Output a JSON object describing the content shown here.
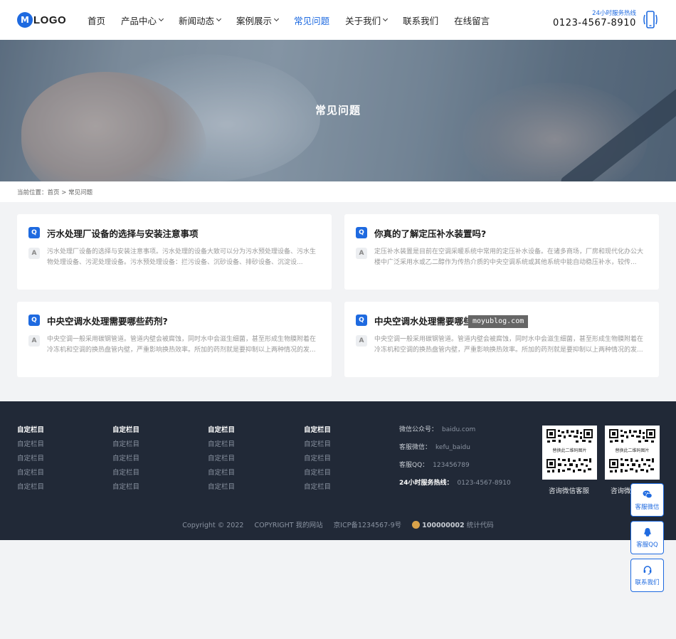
{
  "header": {
    "logo_badge": "M",
    "logo_text": "LOGO",
    "nav": [
      {
        "label": "首页",
        "dropdown": false,
        "active": false
      },
      {
        "label": "产品中心",
        "dropdown": true,
        "active": false
      },
      {
        "label": "新闻动态",
        "dropdown": true,
        "active": false
      },
      {
        "label": "案例展示",
        "dropdown": true,
        "active": false
      },
      {
        "label": "常见问题",
        "dropdown": false,
        "active": true
      },
      {
        "label": "关于我们",
        "dropdown": true,
        "active": false
      },
      {
        "label": "联系我们",
        "dropdown": false,
        "active": false
      },
      {
        "label": "在线留言",
        "dropdown": false,
        "active": false
      }
    ],
    "hotline_label": "24小时服务热线",
    "hotline_number": "0123-4567-8910"
  },
  "banner": {
    "title": "常见问题"
  },
  "breadcrumb": {
    "prefix": "当前位置：",
    "home": "首页",
    "sep": " > ",
    "current": "常见问题"
  },
  "faq": {
    "q_badge": "Q",
    "a_badge": "A",
    "items": [
      {
        "question": "污水处理厂设备的选择与安装注意事项",
        "answer": "污水处理厂设备的选择与安装注意事项。污水处理的设备大致可以分为污水预处理设备、污水生物处理设备、污泥处理设备。污水预处理设备：拦污设备、沉砂设备、排砂设备、沉淀设..."
      },
      {
        "question": "你真的了解定压补水装置吗?",
        "answer": "定压补水装置是目前在空调采暖系统中常用的定压补水设备。在诸多商场，厂房和现代化办公大楼中广泛采用水或乙二醇作为传热介质的中央空调系统或其他系统中能自动稳压补水，较传..."
      },
      {
        "question": "中央空调水处理需要哪些药剂?",
        "answer": "中央空调一般采用碳钢管道。管道内壁会被腐蚀，同时水中会滋生细菌，甚至形成生物膜附着在冷冻机和空调的换热盘管内壁，严重影响换热效率。所加的药剂就是要抑制以上两种情况的发..."
      },
      {
        "question": "中央空调水处理需要哪些",
        "answer": "中央空调一般采用碳钢管道。管道内壁会被腐蚀，同时水中会滋生细菌，甚至形成生物膜附着在冷冻机和空调的换热盘管内壁，严重影响换热效率。所加的药剂就是要抑制以上两种情况的发..."
      }
    ]
  },
  "watermark": "moyublog.com",
  "footer": {
    "columns": [
      {
        "head": "自定栏目",
        "items": [
          "自定栏目",
          "自定栏目",
          "自定栏目",
          "自定栏目"
        ]
      },
      {
        "head": "自定栏目",
        "items": [
          "自定栏目",
          "自定栏目",
          "自定栏目",
          "自定栏目"
        ]
      },
      {
        "head": "自定栏目",
        "items": [
          "自定栏目",
          "自定栏目",
          "自定栏目",
          "自定栏目"
        ]
      },
      {
        "head": "自定栏目",
        "items": [
          "自定栏目",
          "自定栏目",
          "自定栏目",
          "自定栏目"
        ]
      }
    ],
    "contact": [
      {
        "key": "微信公众号：",
        "value": "baidu.com"
      },
      {
        "key": "客服微信：",
        "value": "kefu_baidu"
      },
      {
        "key": "客服QQ：",
        "value": "123456789"
      },
      {
        "key": "24小时服务热线：",
        "value": "0123-4567-8910"
      }
    ],
    "qr": [
      {
        "middle_text": "替换此二维码图片",
        "caption": "咨询微信客服"
      },
      {
        "middle_text": "替换此二维码图片",
        "caption": "咨询微"
      }
    ],
    "copyright": "Copyright © 2022",
    "site": "COPYRIGHT 我的网站",
    "icp": "京ICP备1234567-9号",
    "police": "100000002",
    "stats": "统计代码"
  },
  "float_buttons": [
    {
      "label": "客服微信",
      "icon": "wechat-icon"
    },
    {
      "label": "客服QQ",
      "icon": "qq-icon"
    },
    {
      "label": "联系我们",
      "icon": "headset-icon"
    }
  ],
  "colors": {
    "accent": "#1e6ae0",
    "footer_bg": "#212937",
    "page_bg": "#f2f3f5"
  }
}
